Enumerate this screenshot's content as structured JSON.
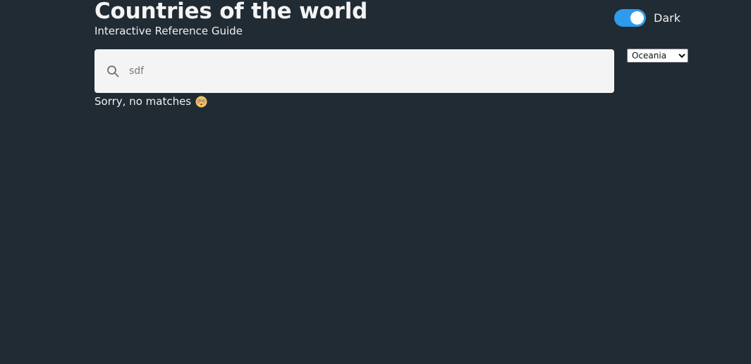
{
  "header": {
    "title": "Countries of the world",
    "subtitle": "Interactive Reference Guide"
  },
  "theme_toggle": {
    "label": "Dark",
    "enabled": true,
    "color": "#2f9bec"
  },
  "search": {
    "value": "sdf",
    "icon": "search-icon"
  },
  "region_filter": {
    "selected": "Oceania"
  },
  "results": {
    "message": "Sorry, no matches",
    "emoji_icon": "flushed-face-icon"
  },
  "colors": {
    "background": "#202b34",
    "search_background": "#f4f4f4"
  }
}
